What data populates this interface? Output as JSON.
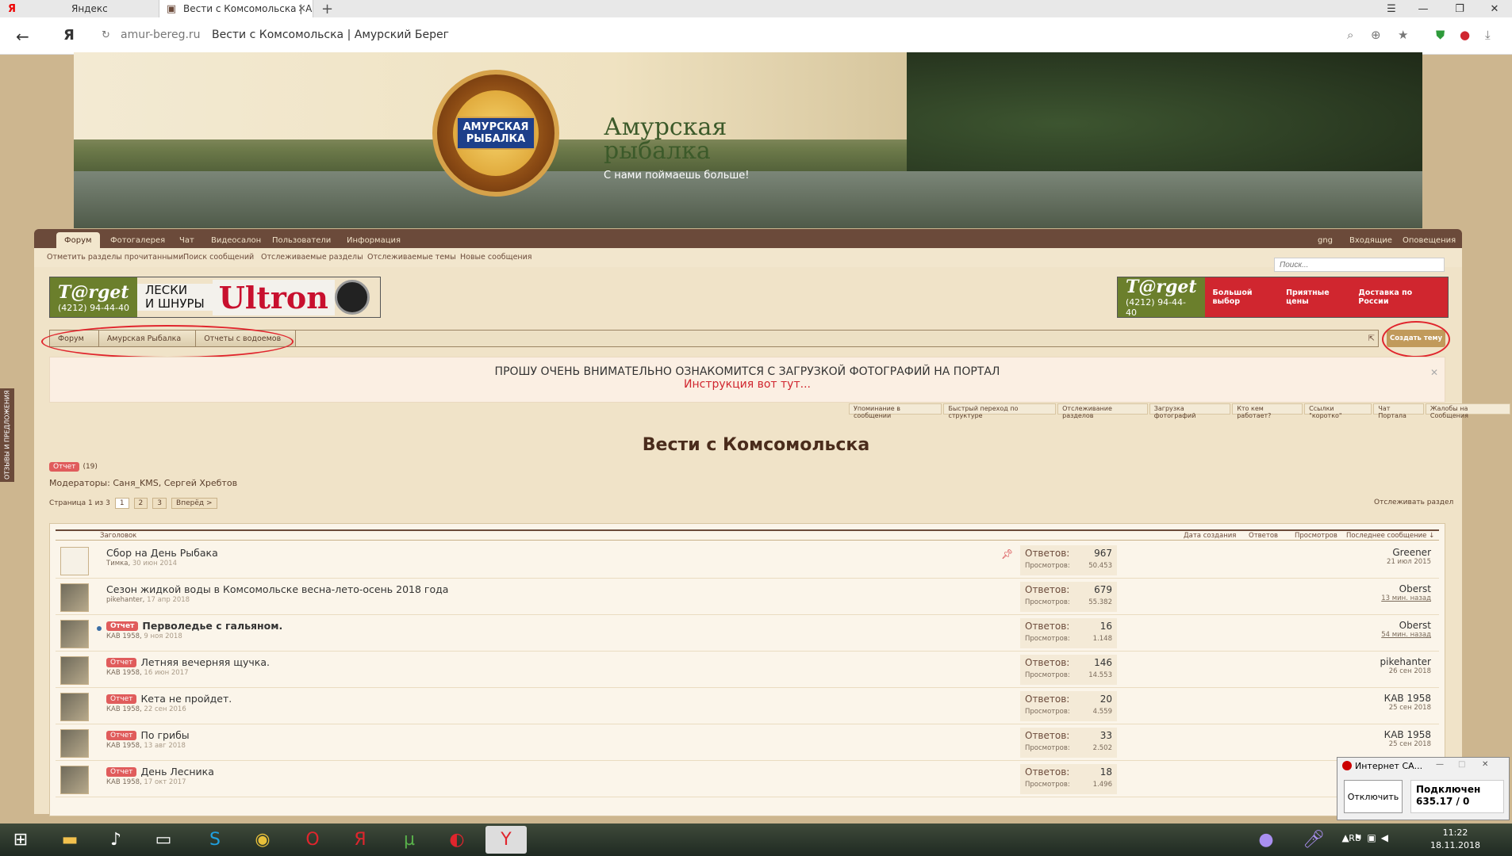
{
  "browser": {
    "tab1": "Яндекс",
    "tab2": "Вести с Комсомольска | А",
    "domain": "amur-bereg.ru",
    "title": "Вести с Комсомольска | Амурский Берег"
  },
  "banner": {
    "logo_plate": "АМУРСКАЯ РЫБАЛКА",
    "title": "Амурская рыбалка",
    "slogan": "С нами поймаешь больше!"
  },
  "nav": {
    "items": [
      "Форум",
      "Фотогалерея",
      "Чат",
      "Видеосалон",
      "Пользователи",
      "Информация"
    ],
    "right": [
      "gng",
      "Входящие",
      "Оповещения"
    ]
  },
  "subnav": [
    "Отметить разделы прочитанными",
    "Поиск сообщений",
    "Отслеживаемые разделы",
    "Отслеживаемые темы",
    "Новые сообщения"
  ],
  "search_placeholder": "Поиск...",
  "ads": {
    "left_brand": "T@rget",
    "left_phone": "(4212) 94-44-40",
    "left_text1": "ЛЕСКИ",
    "left_text2": "И ШНУРЫ",
    "left_logo": "Ultron",
    "right_brand": "T@rget",
    "right_phone": "(4212) 94-44-40",
    "right_f1": "Большой выбор",
    "right_f2": "Приятные цены",
    "right_f3": "Доставка по России"
  },
  "breadcrumb": [
    "Форум",
    "Амурская Рыбалка",
    "Отчеты с водоемов"
  ],
  "create_button": "Создать тему",
  "notice": {
    "line1": "ПРОШУ ОЧЕНЬ ВНИМАТЕЛЬНО ОЗНАКОМИТСЯ С ЗАГРУЗКОЙ ФОТОГРАФИЙ НА ПОРТАЛ",
    "line2": "Инструкция вот тут..."
  },
  "quick_links": [
    "Упоминание в сообщении",
    "Быстрый переход по структуре",
    "Отслеживание разделов",
    "Загрузка фотографий",
    "Кто кем работает?",
    "Ссылки \"коротко\"",
    "Чат Портала",
    "Жалобы на Сообщения"
  ],
  "forum_title": "Вести с Комсомольска",
  "prefix_label": "Отчет",
  "prefix_count": "(19)",
  "moderators": "Модераторы: Саня_KMS, Сергей Хребтов",
  "pager": {
    "label": "Страница 1 из 3",
    "pages": [
      "1",
      "2",
      "3"
    ],
    "next": "Вперёд >"
  },
  "watch": "Отслеживать раздел",
  "columns": {
    "title": "Заголовок",
    "date": "Дата создания",
    "replies": "Ответов",
    "views": "Просмотров",
    "last": "Последнее сообщение ↓"
  },
  "threads": [
    {
      "prefix": "",
      "title": "Сбор на День Рыбака",
      "author": "Тимка,",
      "date": "30 июн 2014",
      "replies": "967",
      "views": "50.453",
      "last_user": "Greener",
      "last_date": "21 июл 2015",
      "pinned": true,
      "bold": false,
      "blank": true
    },
    {
      "prefix": "",
      "title": "Сезон жидкой воды в Комсомольске весна-лето-осень 2018 года",
      "author": "pikehanter,",
      "date": "17 апр 2018",
      "replies": "679",
      "views": "55.382",
      "last_user": "Oberst",
      "last_date": "13 мин. назад",
      "pinned": false,
      "bold": false,
      "blank": false
    },
    {
      "prefix": "Отчет",
      "title": "Перволедье с гальяном.",
      "author": "КАВ 1958,",
      "date": "9 ноя 2018",
      "replies": "16",
      "views": "1.148",
      "last_user": "Oberst",
      "last_date": "54 мин. назад",
      "pinned": false,
      "bold": true,
      "blank": false
    },
    {
      "prefix": "Отчет",
      "title": "Летняя вечерняя щучка.",
      "author": "КАВ 1958,",
      "date": "16 июн 2017",
      "replies": "146",
      "views": "14.553",
      "last_user": "pikehanter",
      "last_date": "26 сен 2018",
      "pinned": false,
      "bold": false,
      "blank": false
    },
    {
      "prefix": "Отчет",
      "title": "Кета не пройдет.",
      "author": "КАВ 1958,",
      "date": "22 сен 2016",
      "replies": "20",
      "views": "4.559",
      "last_user": "КАВ 1958",
      "last_date": "25 сен 2018",
      "pinned": false,
      "bold": false,
      "blank": false
    },
    {
      "prefix": "Отчет",
      "title": "По грибы",
      "author": "КАВ 1958,",
      "date": "13 авг 2018",
      "replies": "33",
      "views": "2.502",
      "last_user": "КАВ 1958",
      "last_date": "25 сен 2018",
      "pinned": false,
      "bold": false,
      "blank": false
    },
    {
      "prefix": "Отчет",
      "title": "День Лесника",
      "author": "КАВ 1958,",
      "date": "17 окт 2017",
      "replies": "18",
      "views": "1.496",
      "last_user": "",
      "last_date": "",
      "pinned": false,
      "bold": false,
      "blank": false
    }
  ],
  "labels": {
    "replies": "Ответов:",
    "views": "Просмотров:"
  },
  "sidebar_tab": "ОТЗЫВЫ И ПРЕДЛОЖЕНИЯ",
  "vpn": {
    "title": "Интернет СА...",
    "button": "Отключить",
    "status": "Подключен",
    "traffic": "635.17 / 0"
  },
  "tray": {
    "lang": "RU",
    "time": "11:22",
    "date": "18.11.2018"
  }
}
